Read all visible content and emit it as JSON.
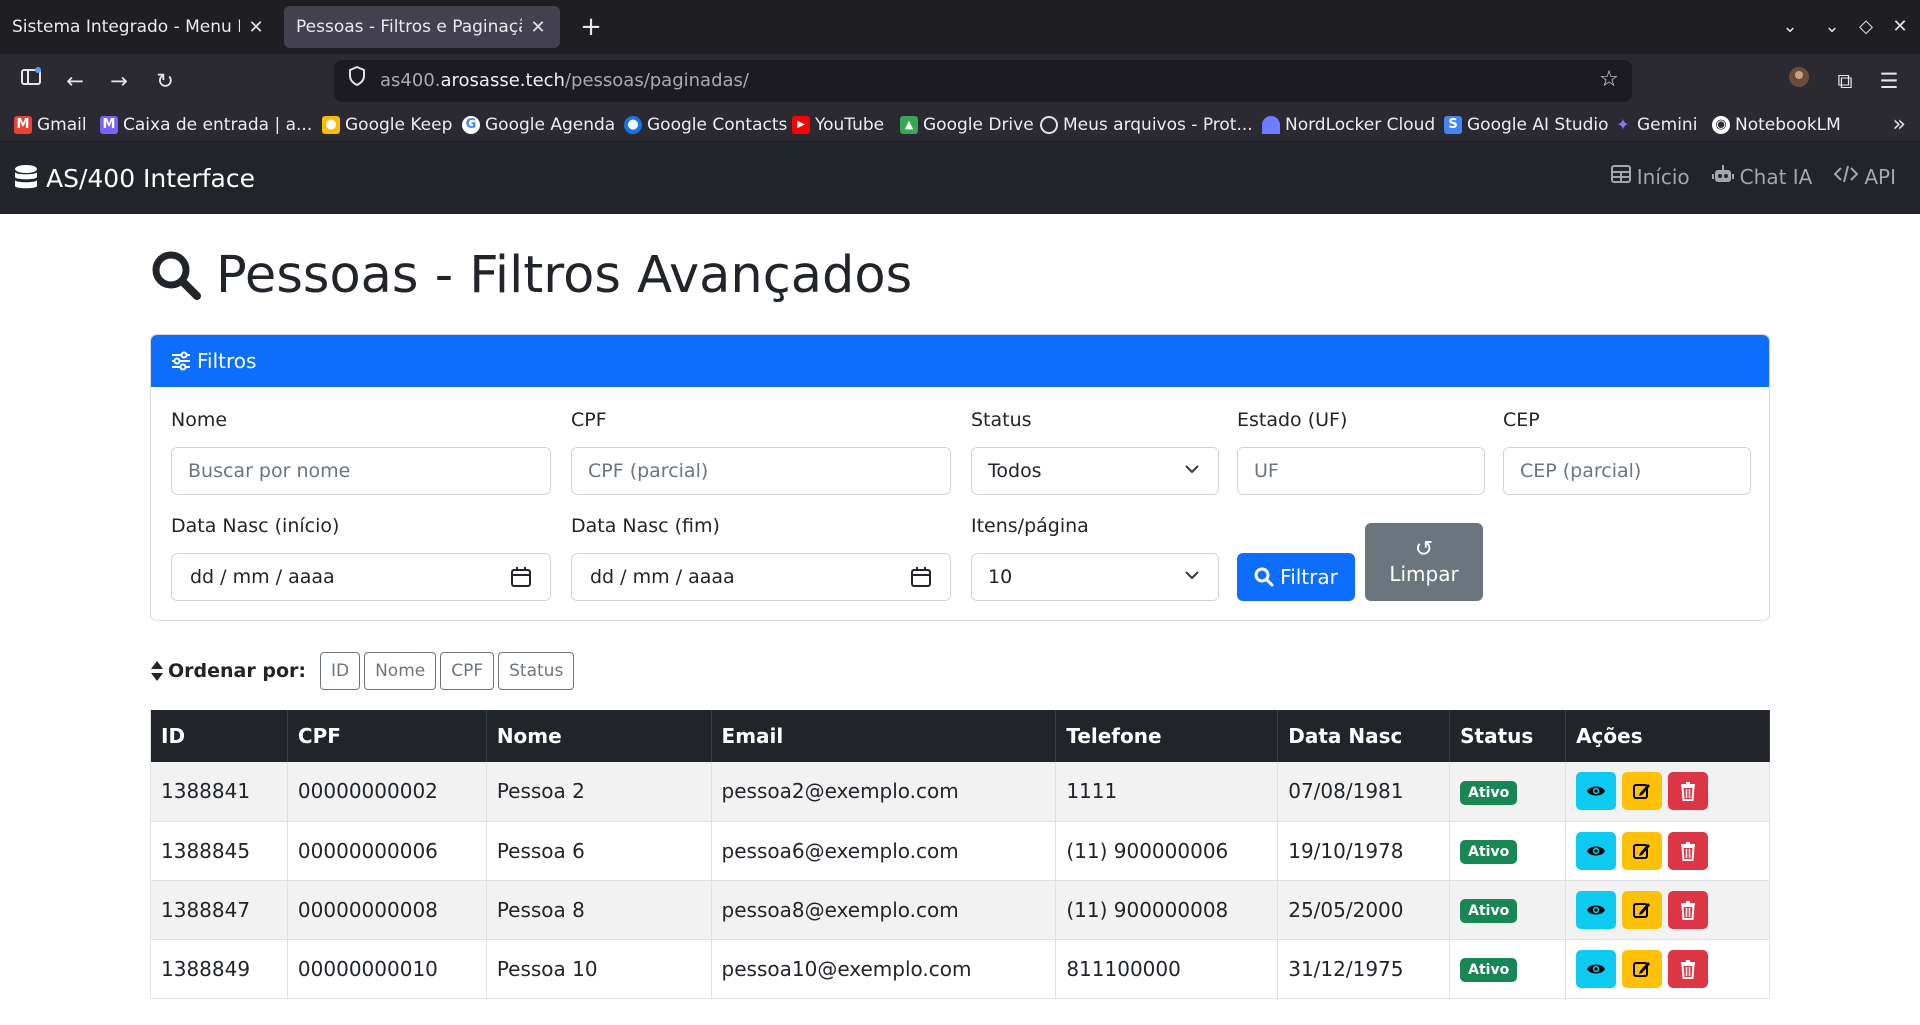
{
  "browser": {
    "tabs": [
      {
        "title": "Sistema Integrado - Menu Principal"
      },
      {
        "title": "Pessoas - Filtros e Paginação"
      }
    ],
    "url_prefix": "as400.",
    "url_host": "arosasse.tech",
    "url_path": "/pessoas/paginadas/",
    "bookmarks": [
      {
        "label": "Gmail",
        "color": "#ea4335",
        "glyph": "M"
      },
      {
        "label": "Caixa de entrada | a...",
        "color": "#7b61ff",
        "glyph": "M"
      },
      {
        "label": "Google Keep",
        "color": "#fbbc04",
        "glyph": "●"
      },
      {
        "label": "Google Agenda",
        "color": "#4285f4",
        "glyph": "G"
      },
      {
        "label": "Google Contacts",
        "color": "#1a73e8",
        "glyph": "●"
      },
      {
        "label": "YouTube",
        "color": "#ff0000",
        "glyph": "▶"
      },
      {
        "label": "Google Drive",
        "color": "#34a853",
        "glyph": "▲"
      },
      {
        "label": "Meus arquivos - Prot...",
        "color": "#2b2a33",
        "glyph": "◎"
      },
      {
        "label": "NordLocker Cloud",
        "color": "#6d7cff",
        "glyph": "◠"
      },
      {
        "label": "Google AI Studio",
        "color": "#4285f4",
        "glyph": "S"
      },
      {
        "label": "Gemini",
        "color": "#8e75ff",
        "glyph": "✦"
      },
      {
        "label": "NotebookLM",
        "color": "#2b2a33",
        "glyph": "◉"
      }
    ]
  },
  "app": {
    "brand": "AS/400 Interface",
    "nav": [
      {
        "label": "Início",
        "icon": "table-icon"
      },
      {
        "label": "Chat IA",
        "icon": "robot-icon"
      },
      {
        "label": "API",
        "icon": "code-icon"
      }
    ]
  },
  "page": {
    "title": "Pessoas - Filtros Avançados"
  },
  "filters": {
    "header": "Filtros",
    "nome_label": "Nome",
    "nome_placeholder": "Buscar por nome",
    "cpf_label": "CPF",
    "cpf_placeholder": "CPF (parcial)",
    "status_label": "Status",
    "status_value": "Todos",
    "uf_label": "Estado (UF)",
    "uf_placeholder": "UF",
    "cep_label": "CEP",
    "cep_placeholder": "CEP (parcial)",
    "data_inicio_label": "Data Nasc (início)",
    "data_inicio_value": "dd / mm / aaaa",
    "data_fim_label": "Data Nasc (fim)",
    "data_fim_value": "dd / mm / aaaa",
    "itens_label": "Itens/página",
    "itens_value": "10",
    "filtrar_label": "Filtrar",
    "limpar_label": "Limpar"
  },
  "ordering": {
    "label": "Ordenar por:",
    "options": [
      "ID",
      "Nome",
      "CPF",
      "Status"
    ]
  },
  "table": {
    "headers": [
      "ID",
      "CPF",
      "Nome",
      "Email",
      "Telefone",
      "Data Nasc",
      "Status",
      "Ações"
    ],
    "rows": [
      {
        "id": "1388841",
        "cpf": "00000000002",
        "nome": "Pessoa 2",
        "email": "pessoa2@exemplo.com",
        "telefone": "1111",
        "data_nasc": "07/08/1981",
        "status": "Ativo"
      },
      {
        "id": "1388845",
        "cpf": "00000000006",
        "nome": "Pessoa 6",
        "email": "pessoa6@exemplo.com",
        "telefone": "(11) 900000006",
        "data_nasc": "19/10/1978",
        "status": "Ativo"
      },
      {
        "id": "1388847",
        "cpf": "00000000008",
        "nome": "Pessoa 8",
        "email": "pessoa8@exemplo.com",
        "telefone": "(11) 900000008",
        "data_nasc": "25/05/2000",
        "status": "Ativo"
      },
      {
        "id": "1388849",
        "cpf": "00000000010",
        "nome": "Pessoa 10",
        "email": "pessoa10@exemplo.com",
        "telefone": "811100000",
        "data_nasc": "31/12/1975",
        "status": "Ativo"
      }
    ]
  },
  "colors": {
    "primary": "#0d6efd",
    "dark": "#212529",
    "success": "#198754",
    "info": "#0dcaf0",
    "warning": "#ffc107",
    "danger": "#dc3545",
    "secondary": "#6c757d"
  }
}
